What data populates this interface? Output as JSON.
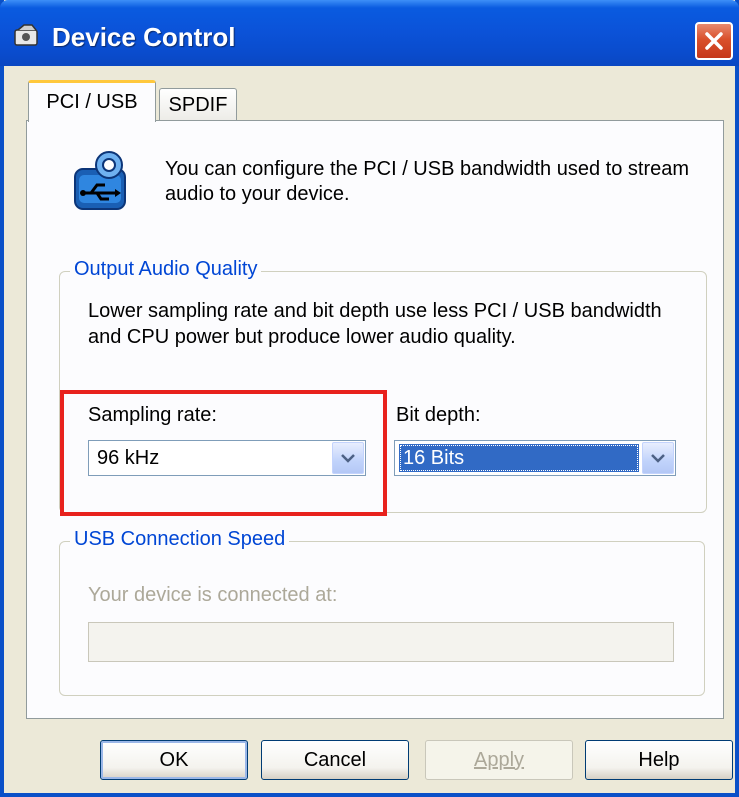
{
  "window": {
    "title": "Device Control",
    "close_icon": "close-x-icon"
  },
  "tabs": [
    {
      "label": "PCI / USB",
      "selected": true
    },
    {
      "label": "SPDIF",
      "selected": false
    }
  ],
  "intro": {
    "icon": "usb-audio-icon",
    "text": "You can configure the PCI / USB bandwidth used to stream audio to your device."
  },
  "output_quality": {
    "legend": "Output Audio Quality",
    "description": "Lower sampling rate and bit depth use less PCI / USB bandwidth and CPU power but produce lower audio quality.",
    "sampling_rate": {
      "label": "Sampling rate:",
      "value": "96 kHz"
    },
    "bit_depth": {
      "label": "Bit depth:",
      "value": "16 Bits"
    }
  },
  "usb_speed": {
    "legend": "USB Connection Speed",
    "description": "Your device is connected at:",
    "value": ""
  },
  "buttons": {
    "ok": "OK",
    "cancel": "Cancel",
    "apply": "Apply",
    "help": "Help"
  },
  "colors": {
    "highlight": "#e8221d",
    "titlebar": "#0b53d9",
    "selection": "#316ac5"
  }
}
